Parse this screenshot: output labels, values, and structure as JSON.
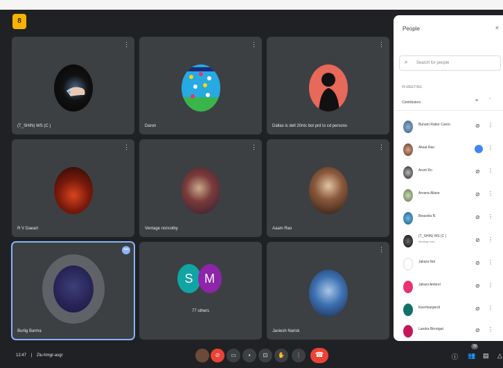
{
  "app": {
    "logo_glyph": "8"
  },
  "tiles": [
    {
      "name": "(T_SHIN) WS (C )",
      "more": "⋮"
    },
    {
      "name": "Daron",
      "more": "⋮"
    },
    {
      "name": "Dallas is dell 20ntc bot prd to cd persons",
      "more": "⋮"
    },
    {
      "name": "R V Gaeart",
      "more": "⋮"
    },
    {
      "name": "Ventage noncolby",
      "more": "⋮"
    },
    {
      "name": "Aaam Rao",
      "more": "⋮"
    },
    {
      "name": "Burlig Barma",
      "more": ""
    },
    {
      "name": "77 others",
      "letters": [
        "S",
        "M"
      ]
    },
    {
      "name": "Janiesh Narisk",
      "more": "⋮"
    }
  ],
  "panel": {
    "title": "People",
    "close": "×",
    "search_placeholder": "Search for people",
    "section_label": "IN MEETING",
    "group_label": "Contributors",
    "people": [
      {
        "name": "Bunam Rabor Caron",
        "sub": ""
      },
      {
        "name": "Aksat Rao",
        "sub": ""
      },
      {
        "name": "Arunt Ro",
        "sub": ""
      },
      {
        "name": "Arvana Allaze",
        "sub": ""
      },
      {
        "name": "Beacelia B.",
        "sub": ""
      },
      {
        "name": "(T_SHIN) WS (C )",
        "sub": "Meeting host"
      },
      {
        "name": "Jakara Net",
        "sub": ""
      },
      {
        "name": "Jahani Ambrol",
        "sub": ""
      },
      {
        "name": "Keerlivargerdi",
        "sub": ""
      },
      {
        "name": "Landra Birrotgat",
        "sub": ""
      }
    ]
  },
  "bottom": {
    "time": "12:47",
    "separator": "|",
    "meeting_code": "Zlu-hmgr-asgr",
    "people_count": "78"
  },
  "colors": {
    "background": "#202124",
    "tile": "#3c4043",
    "red": "#ea4335",
    "accent": "#8ab4f8"
  }
}
